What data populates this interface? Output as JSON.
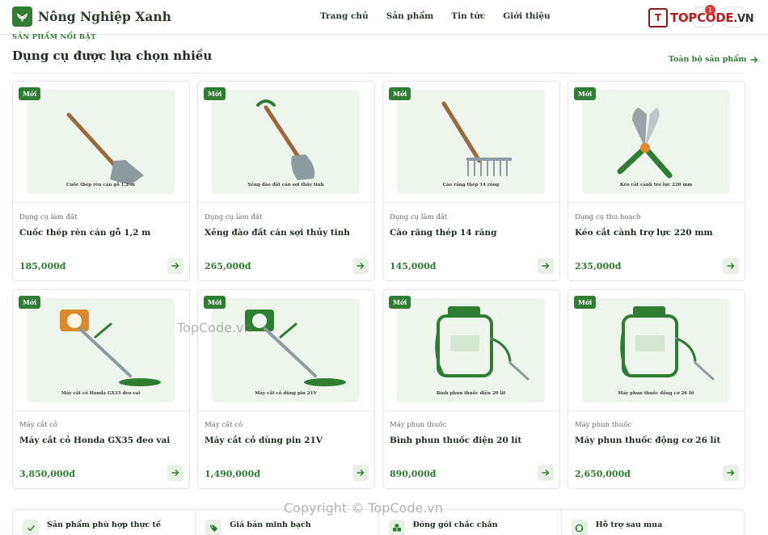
{
  "header": {
    "brand": "Nông Nghiệp Xanh",
    "nav": [
      "Trang chủ",
      "Sản phẩm",
      "Tin tức",
      "Giới thiệu"
    ],
    "watermark_logo": "TOPCODE",
    "watermark_logo_suffix": ".VN",
    "cart_count": "1"
  },
  "section": {
    "eyebrow": "SẢN PHẨM NỔI BẬT",
    "title": "Dụng cụ được lựa chọn nhiều",
    "view_all": "Toàn bộ sản phẩm"
  },
  "badge_label": "Mới",
  "products": [
    {
      "category": "Dụng cụ làm đất",
      "name": "Cuốc thép rèn cán gỗ 1,2 m",
      "price": "185,000đ",
      "caption": "Cuốc thép rèn cán gỗ 1,2 m",
      "icon": "hoe-icon"
    },
    {
      "category": "Dụng cụ làm đất",
      "name": "Xẻng đào đất cán sợi thủy tinh",
      "price": "265,000đ",
      "caption": "Xẻng đào đất cán sợi thủy tinh",
      "icon": "shovel-icon"
    },
    {
      "category": "Dụng cụ làm đất",
      "name": "Cào răng thép 14 răng",
      "price": "145,000đ",
      "caption": "Cào răng thép 14 răng",
      "icon": "rake-icon"
    },
    {
      "category": "Dụng cụ thu hoạch",
      "name": "Kéo cắt cành trợ lực 220 mm",
      "price": "235,000đ",
      "caption": "Kéo cắt cành trợ lực 220 mm",
      "icon": "pruning-shears-icon"
    },
    {
      "category": "Máy cắt cỏ",
      "name": "Máy cắt cỏ Honda GX35 đeo vai",
      "price": "3,850,000đ",
      "caption": "Máy cắt cỏ Honda GX35 đeo vai",
      "icon": "brush-cutter-icon"
    },
    {
      "category": "Máy cắt cỏ",
      "name": "Máy cắt cỏ dùng pin 21V",
      "price": "1,490,000đ",
      "caption": "Máy cắt cỏ dùng pin 21V",
      "icon": "battery-trimmer-icon"
    },
    {
      "category": "Máy phun thuốc",
      "name": "Bình phun thuốc điện 20 lít",
      "price": "890,000đ",
      "caption": "Bình phun thuốc điện 20 lít",
      "icon": "sprayer-icon"
    },
    {
      "category": "Máy phun thuốc",
      "name": "Máy phun thuốc động cơ 26 lít",
      "price": "2,650,000đ",
      "caption": "Máy phun thuốc động cơ 26 lít",
      "icon": "sprayer-icon"
    }
  ],
  "features": [
    {
      "label": "Sản phẩm phù hợp thực tế",
      "icon": "check-icon"
    },
    {
      "label": "Giá bán minh bạch",
      "icon": "tag-icon"
    },
    {
      "label": "Đóng gói chắc chắn",
      "icon": "boxes-icon"
    },
    {
      "label": "Hỗ trợ sau mua",
      "icon": "support-icon"
    }
  ],
  "watermarks": {
    "mid": "TopCode.vn",
    "bottom": "Copyright © TopCode.vn"
  },
  "colors": {
    "accent": "#2f7d32",
    "thumb_bg": "#eef5ec",
    "price": "#2f7d32",
    "badge": "#2f7d32"
  }
}
